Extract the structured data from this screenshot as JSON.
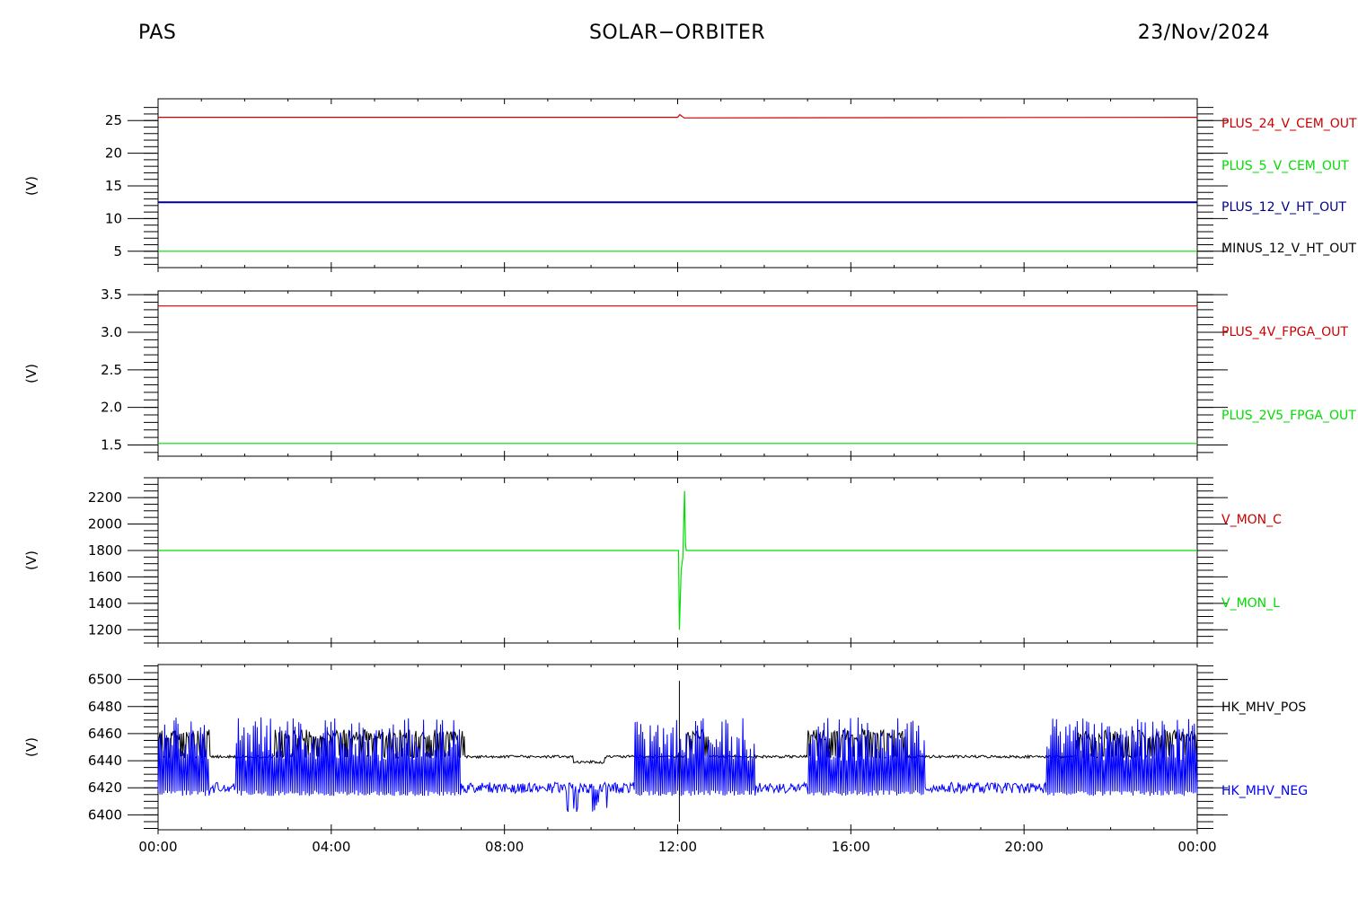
{
  "header": {
    "left": "PAS",
    "center": "SOLAR−ORBITER",
    "right": "23/Nov/2024"
  },
  "x_axis": {
    "ticks": [
      "00:00",
      "04:00",
      "08:00",
      "12:00",
      "16:00",
      "20:00",
      "00:00"
    ],
    "range_hours": [
      0,
      24
    ]
  },
  "colors": {
    "red": "#cc0000",
    "green": "#00dd00",
    "navy": "#000088",
    "blue": "#0000ff",
    "black": "#000000"
  },
  "chart_data": [
    {
      "type": "line",
      "ylabel": "(V)",
      "ylim": [
        2.5,
        27.5
      ],
      "yticks": [
        5,
        10,
        15,
        20,
        25
      ],
      "minor_step": 1,
      "series": [
        {
          "name": "PLUS_24_V_CEM_OUT",
          "color": "#cc0000",
          "x": [
            0,
            12.0,
            12.05,
            12.15,
            24
          ],
          "values": [
            25.5,
            25.5,
            25.9,
            25.4,
            25.5
          ]
        },
        {
          "name": "PLUS_5_V_CEM_OUT",
          "color": "#00dd00",
          "x": [
            0,
            24
          ],
          "values": [
            5.0,
            5.0
          ]
        },
        {
          "name": "PLUS_12_V_HT_OUT",
          "color": "#000088",
          "x": [
            0,
            24
          ],
          "values": [
            12.5,
            12.5
          ]
        },
        {
          "name": "MINUS_12_V_HT_OUT",
          "color": "#000000",
          "x": [],
          "values": []
        }
      ]
    },
    {
      "type": "line",
      "ylabel": "(V)",
      "ylim": [
        1.35,
        3.55
      ],
      "yticks": [
        1.5,
        2.0,
        2.5,
        3.0,
        3.5
      ],
      "ytick_labels": [
        "1.5",
        "2.0",
        "2.5",
        "3.0",
        "3.5"
      ],
      "minor_step": 0.1,
      "series": [
        {
          "name": "PLUS_4V_FPGA_OUT",
          "color": "#cc0000",
          "x": [
            0,
            24
          ],
          "values": [
            3.35,
            3.35
          ]
        },
        {
          "name": "PLUS_2V5_FPGA_OUT",
          "color": "#00dd00",
          "x": [
            0,
            24
          ],
          "values": [
            1.52,
            1.52
          ]
        }
      ]
    },
    {
      "type": "line",
      "ylabel": "(V)",
      "ylim": [
        1100,
        2350
      ],
      "yticks": [
        1200,
        1400,
        1600,
        1800,
        2000,
        2200
      ],
      "minor_step": 50,
      "series": [
        {
          "name": "V_MON_C",
          "color": "#cc0000",
          "x": [],
          "values": []
        },
        {
          "name": "V_MON_L",
          "color": "#00dd00",
          "x": [
            0,
            12.02,
            12.04,
            12.08,
            12.12,
            12.16,
            12.18,
            12.2,
            12.24,
            24
          ],
          "values": [
            1800,
            1800,
            1200,
            1650,
            1750,
            2250,
            1850,
            1800,
            1800,
            1800
          ]
        }
      ]
    },
    {
      "type": "line",
      "ylabel": "(V)",
      "ylim": [
        6389,
        6511
      ],
      "yticks": [
        6400,
        6420,
        6440,
        6460,
        6480,
        6500
      ],
      "minor_step": 5,
      "series": [
        {
          "name": "HK_MHV_POS",
          "color": "#000000"
        },
        {
          "name": "HK_MHV_NEG",
          "color": "#0000ff"
        }
      ]
    }
  ]
}
